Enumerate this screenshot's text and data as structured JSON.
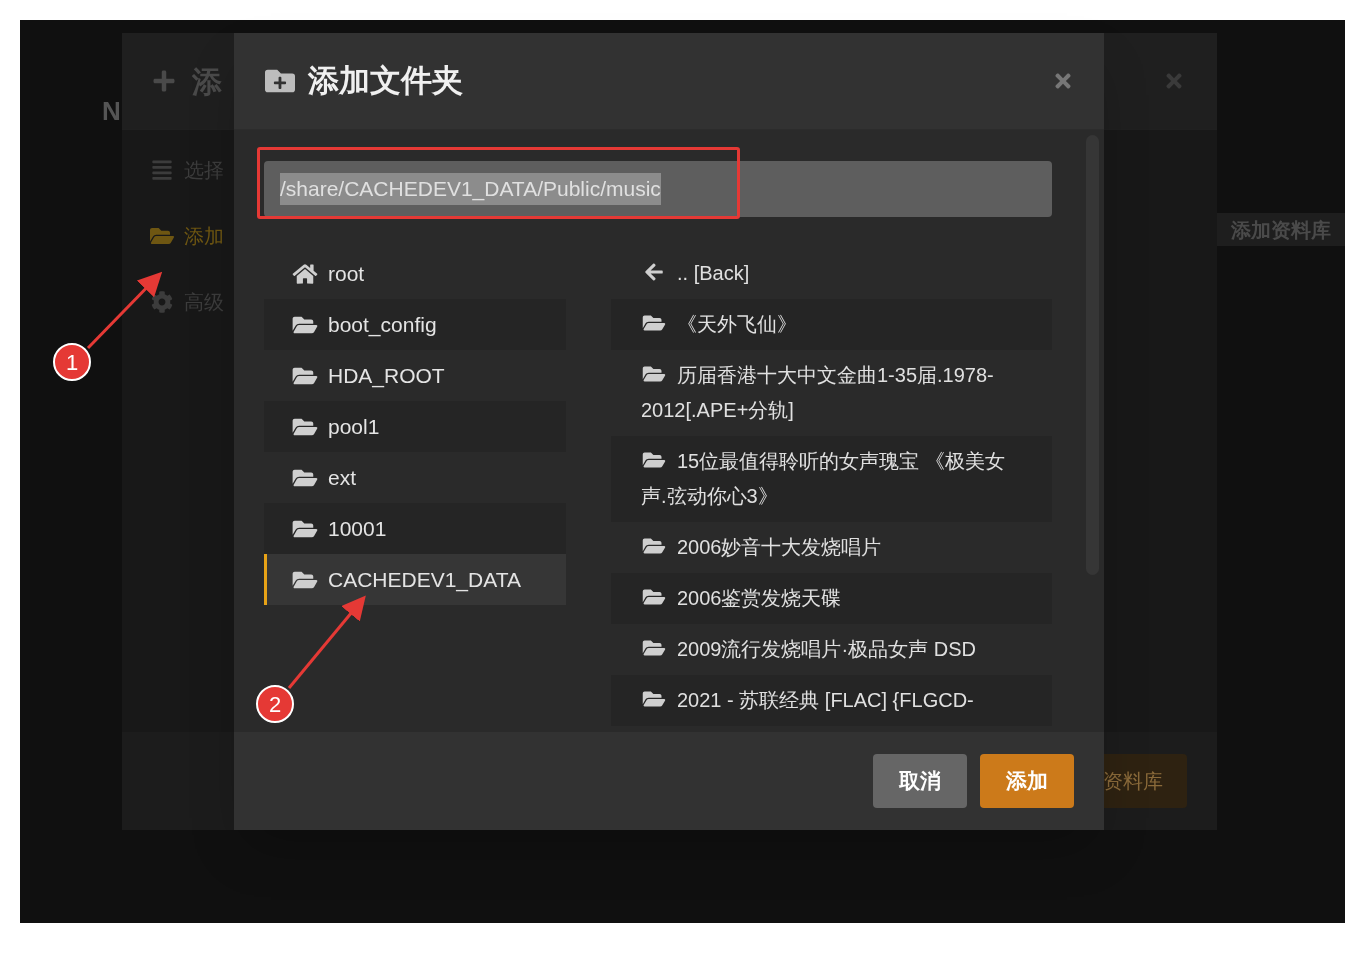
{
  "page_behind": {
    "heading_fragment": "N",
    "side_button": "添加资料库"
  },
  "back_dialog": {
    "title": "添",
    "menu": [
      {
        "label": "选择",
        "kind": "list",
        "selected": false
      },
      {
        "label": "添加",
        "kind": "folder",
        "selected": true
      },
      {
        "label": "高级",
        "kind": "gear",
        "selected": false
      }
    ],
    "confirm_button": "资料库"
  },
  "dialog": {
    "title": "添加文件夹",
    "path": "/share/CACHEDEV1_DATA/Public/music",
    "path_selected": true,
    "locations": [
      {
        "label": "root",
        "kind": "home",
        "selected": false
      },
      {
        "label": "boot_config",
        "kind": "folder",
        "selected": false
      },
      {
        "label": "HDA_ROOT",
        "kind": "folder",
        "selected": false
      },
      {
        "label": "pool1",
        "kind": "folder",
        "selected": false
      },
      {
        "label": "ext",
        "kind": "folder",
        "selected": false
      },
      {
        "label": "10001",
        "kind": "folder",
        "selected": false
      },
      {
        "label": "CACHEDEV1_DATA",
        "kind": "folder",
        "selected": true
      }
    ],
    "folders": [
      {
        "label": ".. [Back]",
        "kind": "back"
      },
      {
        "label": "《天外飞仙》",
        "kind": "folder"
      },
      {
        "label": "历届香港十大中文金曲1-35届.1978-2012[.APE+分轨]",
        "kind": "folder"
      },
      {
        "label": "15位最值得聆听的女声瑰宝 《极美女声.弦动你心3》",
        "kind": "folder"
      },
      {
        "label": "2006妙音十大发烧唱片",
        "kind": "folder"
      },
      {
        "label": "2006鉴赏发烧天碟",
        "kind": "folder"
      },
      {
        "label": "2009流行发烧唱片·极品女声 DSD",
        "kind": "folder"
      },
      {
        "label": "2021 - 苏联经典 [FLAC] {FLGCD-",
        "kind": "folder"
      }
    ],
    "cancel_button": "取消",
    "add_button": "添加"
  },
  "annotations": [
    {
      "label": "1"
    },
    {
      "label": "2"
    }
  ]
}
